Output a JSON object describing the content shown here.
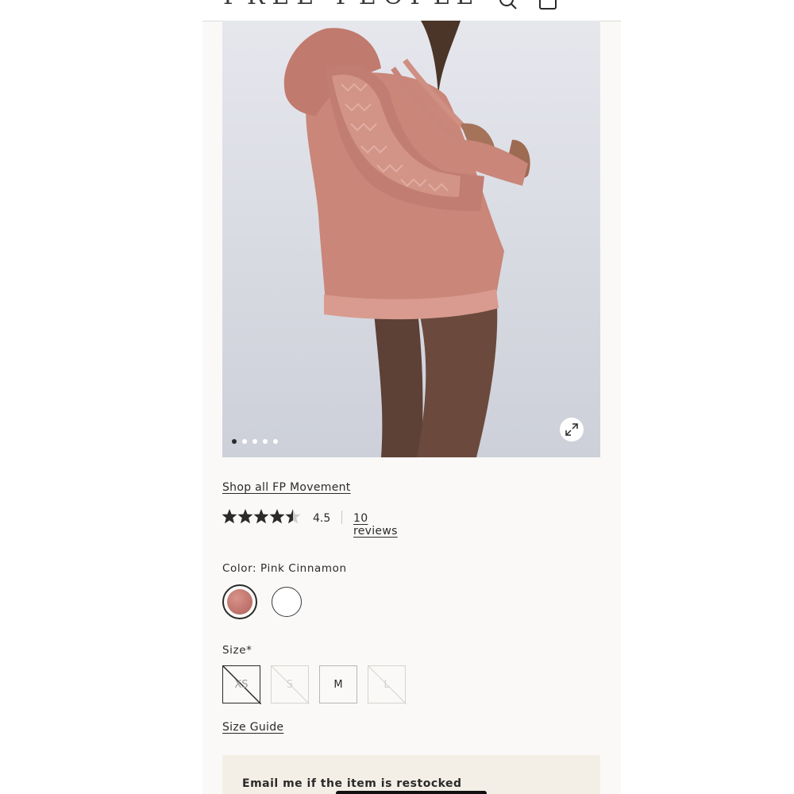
{
  "header": {
    "logo_text": "FREE PEOPLE",
    "search_icon": "search-icon",
    "bag_icon": "shopping-bag-icon"
  },
  "gallery": {
    "image_alt": "Model wearing pink hoodie and brown leggings",
    "total_images": 5,
    "active_index": 0,
    "expand_icon": "expand-icon"
  },
  "product": {
    "shop_link": "Shop all FP Movement",
    "rating": 4.5,
    "rating_text": "4.5",
    "reviews_link": "10 reviews",
    "color_label": "Color: Pink Cinnamon",
    "colors": [
      {
        "name": "Pink Cinnamon",
        "hex": "#c27770",
        "selected": true
      },
      {
        "name": "White",
        "hex": "#ffffff",
        "selected": false
      }
    ],
    "size_label": "Size*",
    "sizes": [
      {
        "label": "XS",
        "available": false,
        "selected": true
      },
      {
        "label": "S",
        "available": false,
        "selected": false
      },
      {
        "label": "M",
        "available": true,
        "selected": false
      },
      {
        "label": "L",
        "available": false,
        "selected": false
      }
    ],
    "size_guide": "Size Guide",
    "restock_text": "Email me if the item is restocked"
  }
}
